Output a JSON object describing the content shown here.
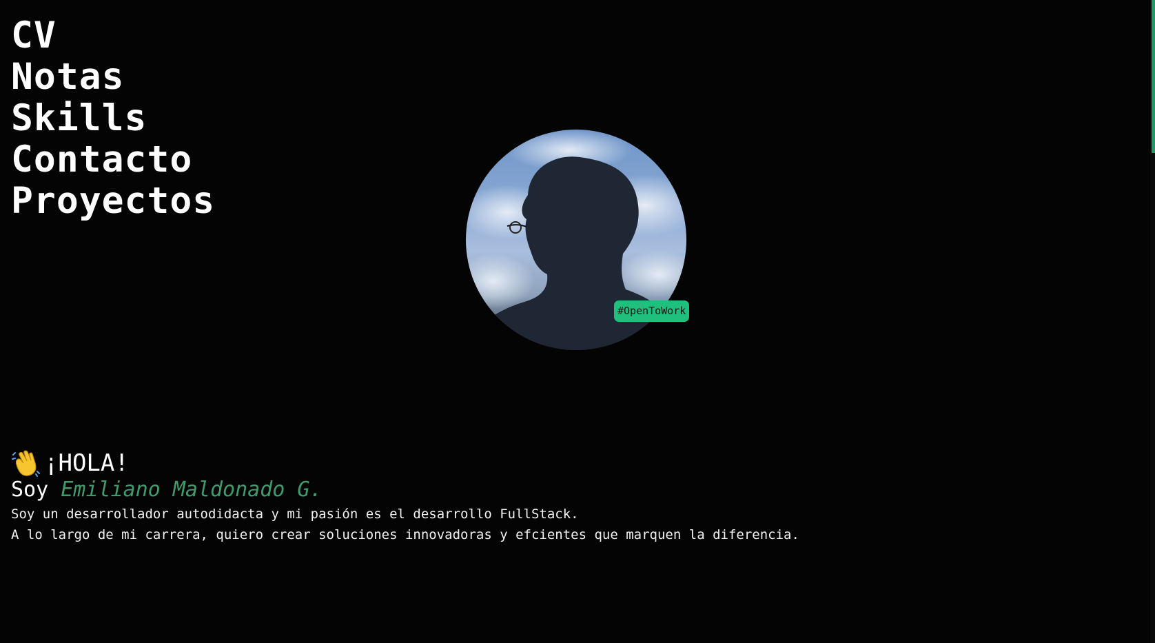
{
  "nav": {
    "items": [
      {
        "label": "CV"
      },
      {
        "label": "Notas"
      },
      {
        "label": "Skills"
      },
      {
        "label": "Contacto"
      },
      {
        "label": "Proyectos"
      }
    ]
  },
  "profile": {
    "badge": "#OpenToWork"
  },
  "intro": {
    "greeting": "¡HOLA!",
    "soy": "Soy",
    "name": "Emiliano Maldonado G.",
    "line1": "Soy un desarrollador autodidacta y mi pasión es el desarrollo FullStack.",
    "line2": "A lo largo de mi carrera, quiero crear soluciones innovadoras y efcientes que marquen la diferencia."
  },
  "colors": {
    "background": "#040404",
    "accent": "#1fbf7e",
    "name_color": "#3f9a6d",
    "text": "#ffffff"
  },
  "icons": {
    "greeting_icon": "waving-hand-icon"
  }
}
